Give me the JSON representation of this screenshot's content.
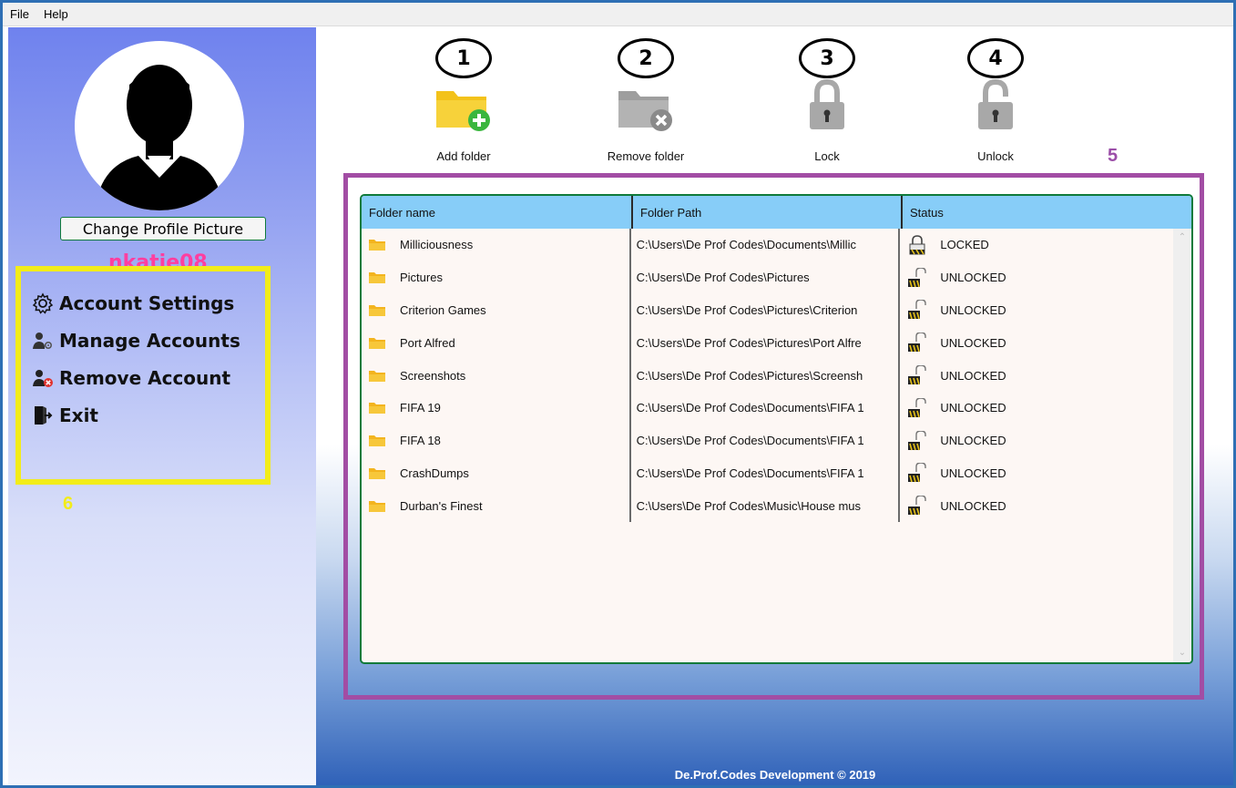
{
  "menubar": {
    "items": [
      "File",
      "Help"
    ]
  },
  "sidebar": {
    "change_picture_label": "Change Profile Picture",
    "username": "nkatie08",
    "annotation": "6",
    "items": [
      {
        "label": "Account Settings",
        "icon": "gear-icon"
      },
      {
        "label": "Manage Accounts",
        "icon": "users-settings-icon"
      },
      {
        "label": "Remove Account",
        "icon": "user-remove-icon"
      },
      {
        "label": "Exit",
        "icon": "exit-icon"
      }
    ]
  },
  "toolbar": {
    "buttons": [
      {
        "number": "1",
        "label": "Add folder",
        "icon": "folder-add-icon"
      },
      {
        "number": "2",
        "label": "Remove folder",
        "icon": "folder-remove-icon"
      },
      {
        "number": "3",
        "label": "Lock",
        "icon": "lock-icon"
      },
      {
        "number": "4",
        "label": "Unlock",
        "icon": "unlock-icon"
      }
    ]
  },
  "panel_annotation": "5",
  "grid": {
    "columns": [
      "Folder name",
      "Folder Path",
      "Status"
    ],
    "rows": [
      {
        "name": "Milliciousness",
        "path": "C:\\Users\\De Prof Codes\\Documents\\Millic",
        "status": "LOCKED"
      },
      {
        "name": "Pictures",
        "path": "C:\\Users\\De Prof Codes\\Pictures",
        "status": "UNLOCKED"
      },
      {
        "name": "Criterion Games",
        "path": "C:\\Users\\De Prof Codes\\Pictures\\Criterion",
        "status": "UNLOCKED"
      },
      {
        "name": "Port Alfred",
        "path": "C:\\Users\\De Prof Codes\\Pictures\\Port Alfre",
        "status": "UNLOCKED"
      },
      {
        "name": "Screenshots",
        "path": "C:\\Users\\De Prof Codes\\Pictures\\Screensh",
        "status": "UNLOCKED"
      },
      {
        "name": "FIFA 19",
        "path": "C:\\Users\\De Prof Codes\\Documents\\FIFA 1",
        "status": "UNLOCKED"
      },
      {
        "name": "FIFA 18",
        "path": "C:\\Users\\De Prof Codes\\Documents\\FIFA 1",
        "status": "UNLOCKED"
      },
      {
        "name": "CrashDumps",
        "path": "C:\\Users\\De Prof Codes\\Documents\\FIFA 1",
        "status": "UNLOCKED"
      },
      {
        "name": "Durban's Finest",
        "path": "C:\\Users\\De Prof Codes\\Music\\House mus",
        "status": "UNLOCKED"
      }
    ]
  },
  "footer": "De.Prof.Codes Development © 2019",
  "colors": {
    "grid_header": "#87cdf8",
    "grid_border": "#0f7a3b",
    "panel_frame": "#a24da4",
    "menu_box": "#f2ec1a",
    "username": "#ff3fa0",
    "window_border": "#2e6fb4"
  }
}
